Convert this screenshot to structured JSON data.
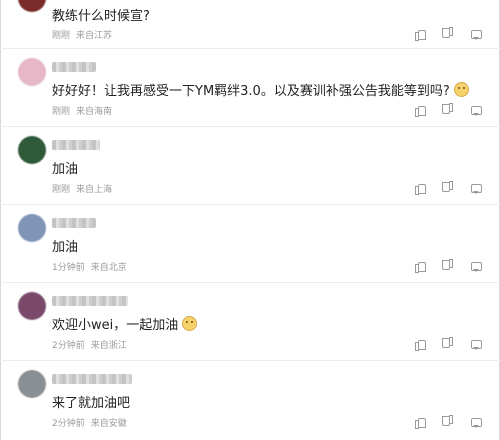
{
  "comments": [
    {
      "text": "教练什么时候宣?",
      "time": "刚刚",
      "location": "来自江苏",
      "avatar_color": "#7a2a2a"
    },
    {
      "text": "好好好！让我再感受一下YM羁绊3.0。以及赛训补强公告我能等到吗?",
      "time": "刚刚",
      "location": "来自海南",
      "avatar_color": "#e6b7c7",
      "emoji": "smile-emoji"
    },
    {
      "text": "加油",
      "time": "刚刚",
      "location": "来自上海",
      "avatar_color": "#2f5a3a"
    },
    {
      "text": "加油",
      "time": "1分钟前",
      "location": "来自北京",
      "avatar_color": "#7f95b6"
    },
    {
      "text": "欢迎小wei，一起加油",
      "time": "2分钟前",
      "location": "来自浙江",
      "avatar_color": "#7b4a6a",
      "emoji": "laugh-emoji"
    },
    {
      "text": "来了就加油吧",
      "time": "2分钟前",
      "location": "来自安徽",
      "avatar_color": "#8a8f96"
    }
  ]
}
